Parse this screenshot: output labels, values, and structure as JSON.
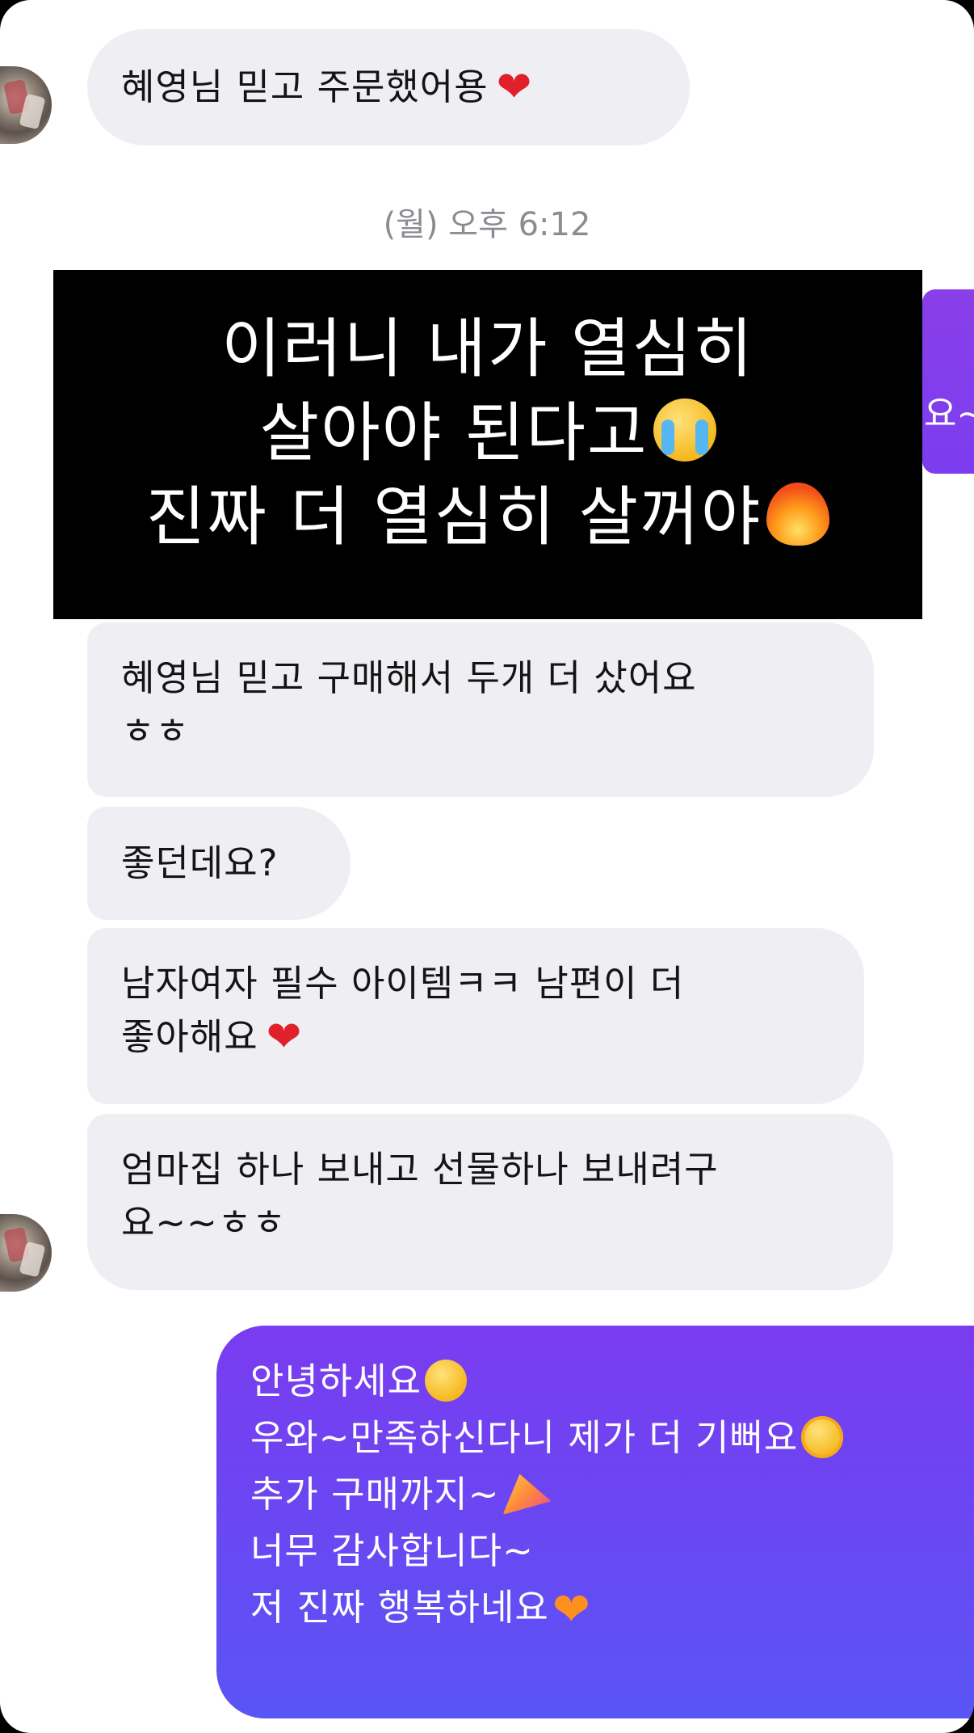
{
  "chat": {
    "received_top": "혜영님 믿고 주문했어용",
    "timestamp": "(월) 오후 6:12",
    "sent_partial": "요~",
    "caption_lines": [
      "이러니 내가 열심히",
      "살아야 된다고",
      "진짜 더 열심히 살꺼야"
    ],
    "received": [
      [
        "혜영님 믿고 구매해서 두개 더 샀어요",
        "ㅎㅎ"
      ],
      [
        "좋던데요?"
      ],
      [
        "남자여자 필수 아이템ㅋㅋ 남편이 더",
        "좋아해요"
      ],
      [
        "엄마집 하나 보내고 선물하나 보내려구",
        "요~~ㅎㅎ"
      ]
    ],
    "sent_lines": [
      "안녕하세요",
      "우와~만족하신다니 제가 더 기뻐요",
      "추가 구매까지~",
      "너무 감사합니다~",
      "저 진짜 행복하네요"
    ],
    "icons": {
      "heart": "red-heart-emoji",
      "cry": "loudly-crying-face-emoji",
      "fire": "fire-emoji",
      "wink": "winking-face-emoji",
      "star_eyes": "star-struck-emoji",
      "party": "party-popper-emoji",
      "orange_heart": "orange-heart-emoji"
    },
    "colors": {
      "received_bubble": "#efeff3",
      "sent_gradient_top": "#7a3cf0",
      "sent_gradient_bottom": "#5a55f5",
      "timestamp": "#8b8b92"
    }
  }
}
